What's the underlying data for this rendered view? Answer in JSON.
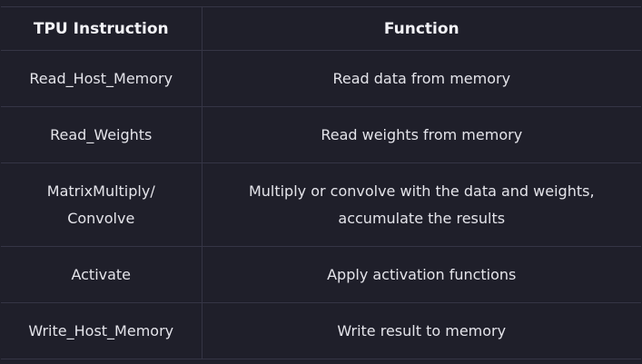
{
  "table": {
    "headers": [
      "TPU Instruction",
      "Function"
    ],
    "rows": [
      {
        "instruction": "Read_Host_Memory",
        "function": "Read data from memory"
      },
      {
        "instruction": "Read_Weights",
        "function": "Read weights from memory"
      },
      {
        "instruction_lines": [
          "MatrixMultiply/",
          "Convolve"
        ],
        "function_lines": [
          "Multiply or convolve with the data and weights,",
          "accumulate the results"
        ]
      },
      {
        "instruction": "Activate",
        "function": "Apply activation functions"
      },
      {
        "instruction": "Write_Host_Memory",
        "function": "Write result to memory"
      }
    ]
  }
}
